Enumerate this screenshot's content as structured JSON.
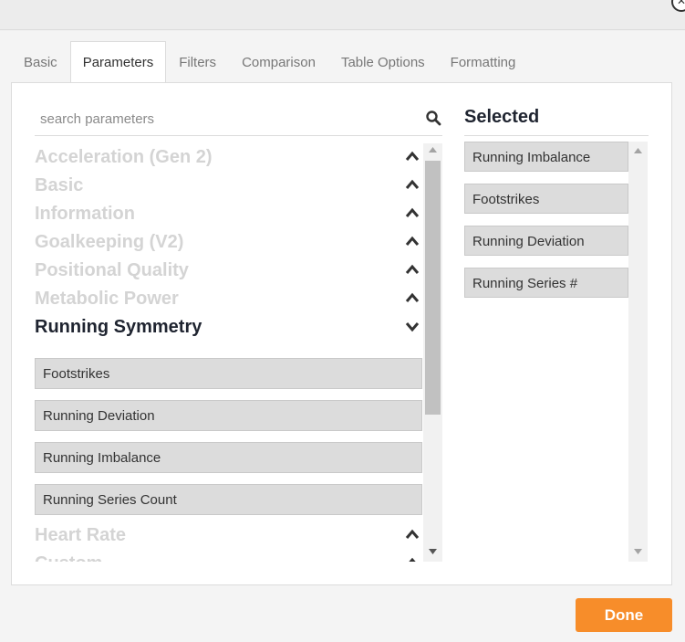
{
  "tabs": [
    {
      "label": "Basic",
      "active": false
    },
    {
      "label": "Parameters",
      "active": true
    },
    {
      "label": "Filters",
      "active": false
    },
    {
      "label": "Comparison",
      "active": false
    },
    {
      "label": "Table Options",
      "active": false
    },
    {
      "label": "Formatting",
      "active": false
    }
  ],
  "search": {
    "placeholder": "search parameters",
    "icon": "search-icon"
  },
  "groups": [
    {
      "label": "Acceleration (Gen 2)",
      "expanded": false
    },
    {
      "label": "Basic",
      "expanded": false
    },
    {
      "label": "Information",
      "expanded": false
    },
    {
      "label": "Goalkeeping (V2)",
      "expanded": false
    },
    {
      "label": "Positional Quality",
      "expanded": false
    },
    {
      "label": "Metabolic Power",
      "expanded": false
    },
    {
      "label": "Running Symmetry",
      "expanded": true
    },
    {
      "label": "Heart Rate",
      "expanded": false
    },
    {
      "label": "Custom",
      "expanded": false
    }
  ],
  "running_symmetry_items": [
    "Footstrikes",
    "Running Deviation",
    "Running Imbalance",
    "Running Series Count"
  ],
  "selected": {
    "title": "Selected",
    "items": [
      "Running Imbalance",
      "Footstrikes",
      "Running Deviation",
      "Running Series #"
    ]
  },
  "footer": {
    "done_label": "Done",
    "done_color": "#f78d2a"
  }
}
